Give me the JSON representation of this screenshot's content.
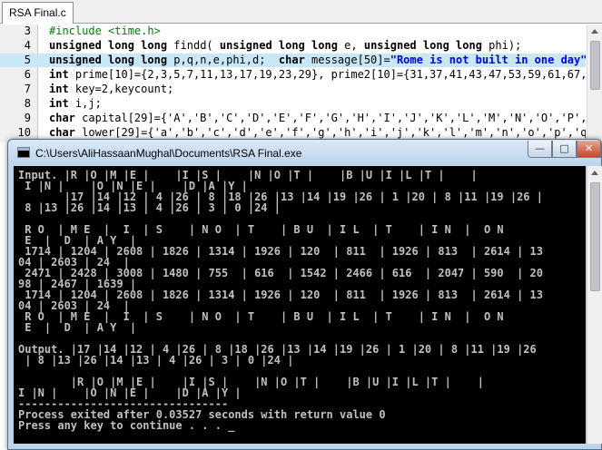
{
  "editor": {
    "tab_label": "RSA Final.c",
    "lines": [
      {
        "num": "3",
        "text": "#include <time.h>"
      },
      {
        "num": "4",
        "text": "unsigned long long findd( unsigned long long e, unsigned long long phi);"
      },
      {
        "num": "5",
        "text": "unsigned long long p,q,n,e,phi,d;  char message[50]=\"Rome is not built in one day\";"
      },
      {
        "num": "6",
        "text": "int prime[10]={2,3,5,7,11,13,17,19,23,29}, prime2[10]={31,37,41,43,47,53,59,61,67,71"
      },
      {
        "num": "7",
        "text": "int key=2,keycount;"
      },
      {
        "num": "8",
        "text": "int i,j;"
      },
      {
        "num": "9",
        "text": "char capital[29]={'A','B','C','D','E','F','G','H','I','J','K','L','M','N','O','P','Q"
      },
      {
        "num": "10",
        "text": "char lower[29]={'a','b','c','d','e','f','g','h','i','j','k','l','m','n','o','p','q',"
      }
    ]
  },
  "console": {
    "title": "C:\\Users\\AliHassaanMughal\\Documents\\RSA Final.exe",
    "minimize_glyph": "—",
    "maximize_glyph": "□",
    "close_glyph": "✕",
    "output": [
      "Input. |R |O |M |E |    |I |S |    |N |O |T |    |B |U |I |L |T |    |",
      " I |N |    |O |N |E |    |D |A |Y |",
      "       |17 |14 |12 | 4 |26 | 8 |18 |26 |13 |14 |19 |26 | 1 |20 | 8 |11 |19 |26 |",
      " 8 |13 |26 |14 |13 | 4 |26 | 3 | 0 |24 |",
      "",
      " R O  | M E  |  I  | S    | N O  | T    | B U  | I L  | T    | I N  |  O N",
      " E  |  D  | A Y  |",
      " 1714 | 1204 | 2608 | 1826 | 1314 | 1926 | 120  | 811  | 1926 | 813  | 2614 | 13",
      "04 | 2603 | 24  |",
      " 2471 | 2428 | 3008 | 1480 | 755  | 616  | 1542 | 2466 | 616  | 2047 | 590  | 20",
      "98 | 2467 | 1639 |",
      " 1714 | 1204 | 2608 | 1826 | 1314 | 1926 | 120  | 811  | 1926 | 813  | 2614 | 13",
      "04 | 2603 | 24  |",
      " R O  | M E  |  I  | S    | N O  | T    | B U  | I L  | T    | I N  |  O N",
      " E  |  D  | A Y  |",
      "",
      "Output. |17 |14 |12 | 4 |26 | 8 |18 |26 |13 |14 |19 |26 | 1 |20 | 8 |11 |19 |26",
      " | 8 |13 |26 |14 |13 | 4 |26 | 3 | 0 |24 |",
      "",
      "        |R |O |M |E |    |I |S |    |N |O |T |    |B |U |I |L |T |    |",
      "I |N |    |O |N |E |    |D |A |Y |",
      "--------------------------------",
      "Process exited after 0.03527 seconds with return value 0",
      "Press any key to continue . . . _"
    ]
  }
}
